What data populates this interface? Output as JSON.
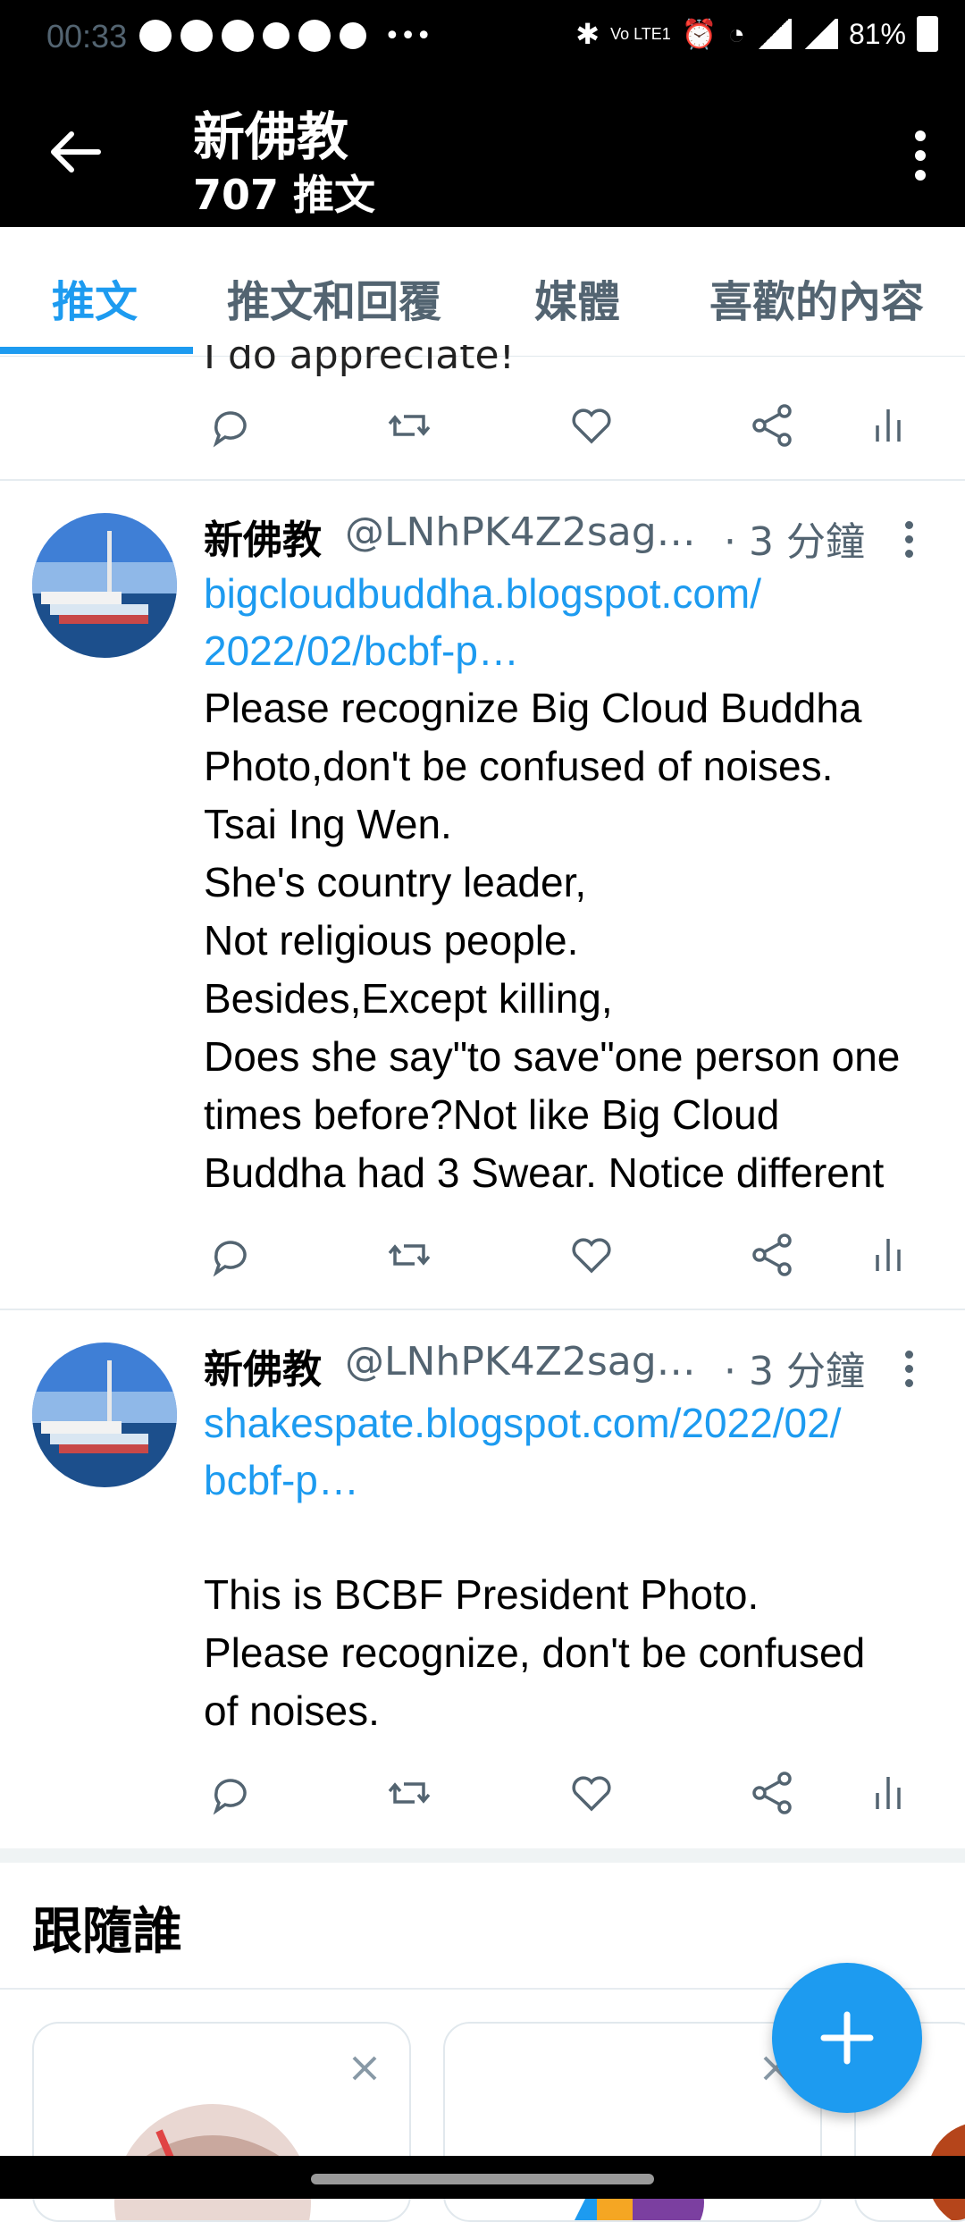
{
  "status_bar": {
    "time": "00:33",
    "battery": "81%",
    "icons": [
      "messenger-icon",
      "messenger-icon",
      "messenger-icon",
      "missed-call-icon",
      "line-icon",
      "location-icon",
      "more-icon"
    ],
    "right_icons": [
      "bluetooth-icon",
      "volte-icon",
      "alarm-icon",
      "wifi-icon",
      "signal-5g-icon",
      "signal-icon",
      "battery-icon"
    ]
  },
  "header": {
    "title": "新佛教",
    "subtitle": "707 推文"
  },
  "tabs": [
    {
      "label": "推文",
      "active": true
    },
    {
      "label": "推文和回覆",
      "active": false
    },
    {
      "label": "媒體",
      "active": false
    },
    {
      "label": "喜歡的內容",
      "active": false
    }
  ],
  "partial_tweet": {
    "text": "I do appreciate!"
  },
  "tweets": [
    {
      "name": "新佛教",
      "handle": "@LNhPK4Z2sag…",
      "time": "· 3 分鐘",
      "link": "bigcloudbuddha.blogspot.com/\n2022/02/bcbf-p…",
      "body": "Please recognize Big Cloud Buddha\nPhoto,don't be confused of noises.\nTsai Ing Wen.\nShe's country leader,\nNot religious people.\nBesides,Except killing,\nDoes she say\"to save\"one person one\ntimes before?Not like Big Cloud\nBuddha had 3 Swear. Notice different"
    },
    {
      "name": "新佛教",
      "handle": "@LNhPK4Z2sag…",
      "time": "· 3 分鐘",
      "link": "shakespate.blogspot.com/2022/02/\nbcbf-p…",
      "body": "This is BCBF President Photo.\nPlease recognize, don't be confused\nof noises."
    }
  ],
  "who_to_follow": {
    "title": "跟隨誰"
  },
  "colors": {
    "accent": "#1d9bf0",
    "header_bg": "#000000",
    "secondary_text": "#536471"
  }
}
